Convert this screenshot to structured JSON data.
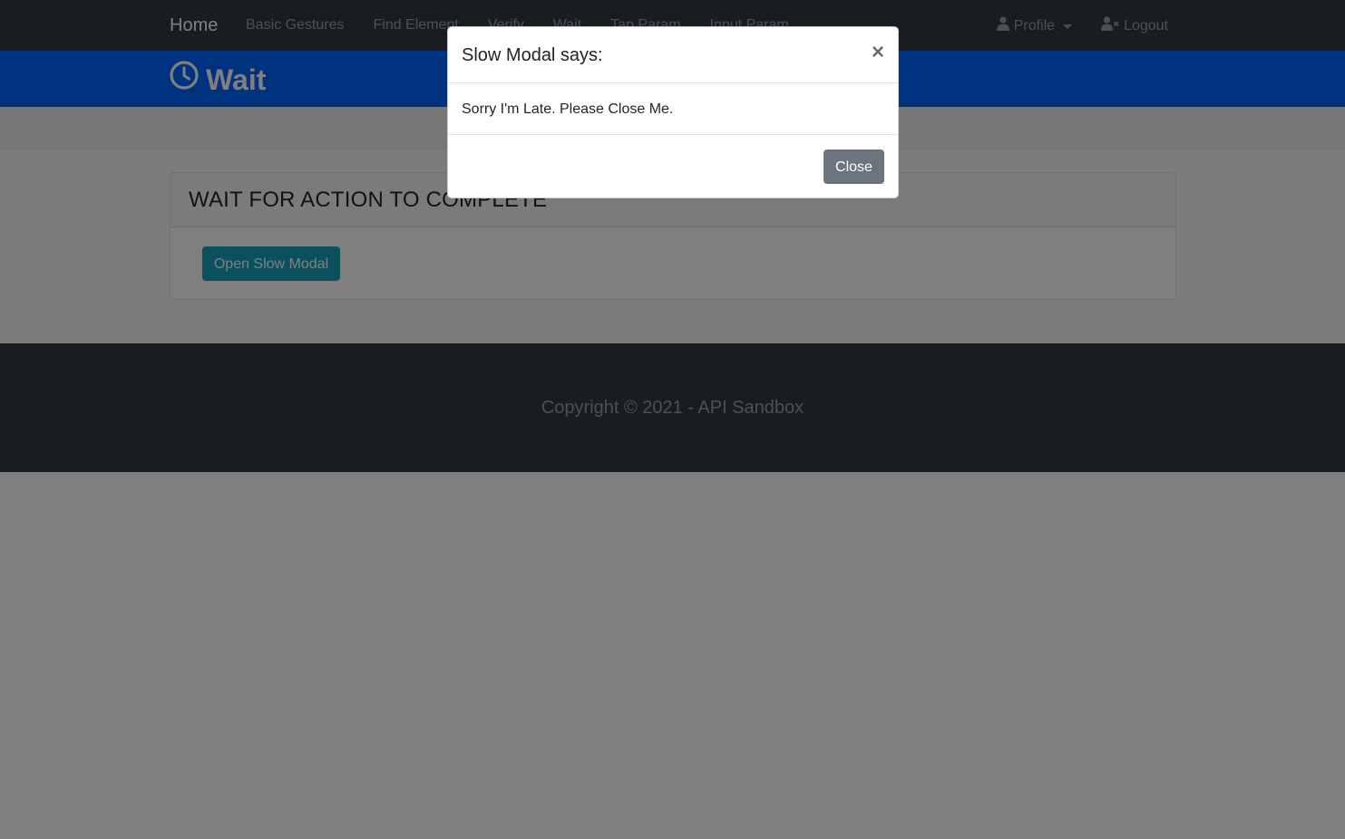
{
  "navbar": {
    "brand": "Home",
    "links": [
      "Basic Gestures",
      "Find Element",
      "Verify",
      "Wait",
      "Tap Param",
      "Input Param"
    ],
    "profile_label": "Profile",
    "profile_icon": "user-icon",
    "logout_label": "Logout",
    "logout_icon": "user-x-icon"
  },
  "header": {
    "title": "Wait",
    "icon": "clock-icon"
  },
  "card": {
    "title": "WAIT FOR ACTION TO COMPLETE",
    "button_label": "Open Slow Modal"
  },
  "footer": {
    "text": "Copyright © 2021 - API Sandbox"
  },
  "modal": {
    "title": "Slow Modal says:",
    "close_x": "×",
    "body": "Sorry I'm Late. Please Close Me.",
    "close_button": "Close"
  },
  "colors": {
    "navbar": "#343a40",
    "header_band": "#0066ff",
    "info_button": "#17a2b8",
    "secondary_button": "#6c757d"
  }
}
